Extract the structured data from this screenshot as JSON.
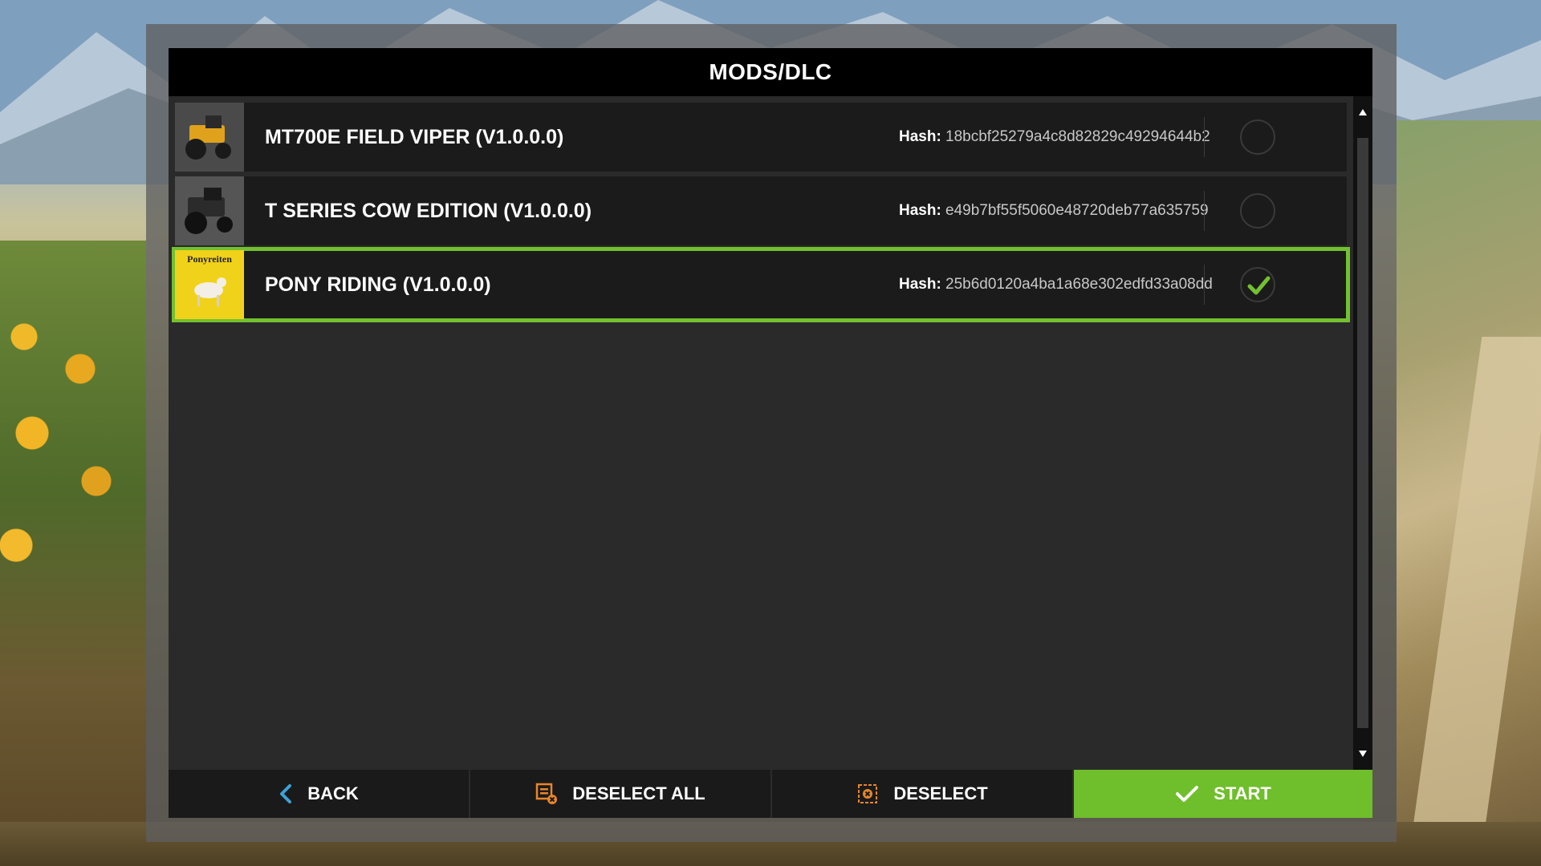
{
  "header": {
    "title": "MODS/DLC"
  },
  "mods": [
    {
      "name": "MT700E FIELD VIPER (V1.0.0.0)",
      "hash_label": "Hash:",
      "hash": "18bcbf25279a4c8d82829c49294644b2",
      "selected": false,
      "thumb_icon": "tractor-thumbnail"
    },
    {
      "name": "T SERIES COW EDITION (V1.0.0.0)",
      "hash_label": "Hash:",
      "hash": "e49b7bf55f5060e48720deb77a635759",
      "selected": false,
      "thumb_icon": "tractor-thumbnail"
    },
    {
      "name": "PONY RIDING (V1.0.0.0)",
      "hash_label": "Hash:",
      "hash": "25b6d0120a4ba1a68e302edfd33a08dd",
      "selected": true,
      "thumb_icon": "pony-thumbnail",
      "thumb_text": "Ponyreiten"
    }
  ],
  "footer": {
    "back_label": "BACK",
    "deselect_all_label": "DESELECT ALL",
    "deselect_label": "DESELECT",
    "start_label": "START"
  },
  "colors": {
    "accent": "#73c031",
    "icon_orange": "#e8862a",
    "back_arrow": "#3fa0d8"
  }
}
